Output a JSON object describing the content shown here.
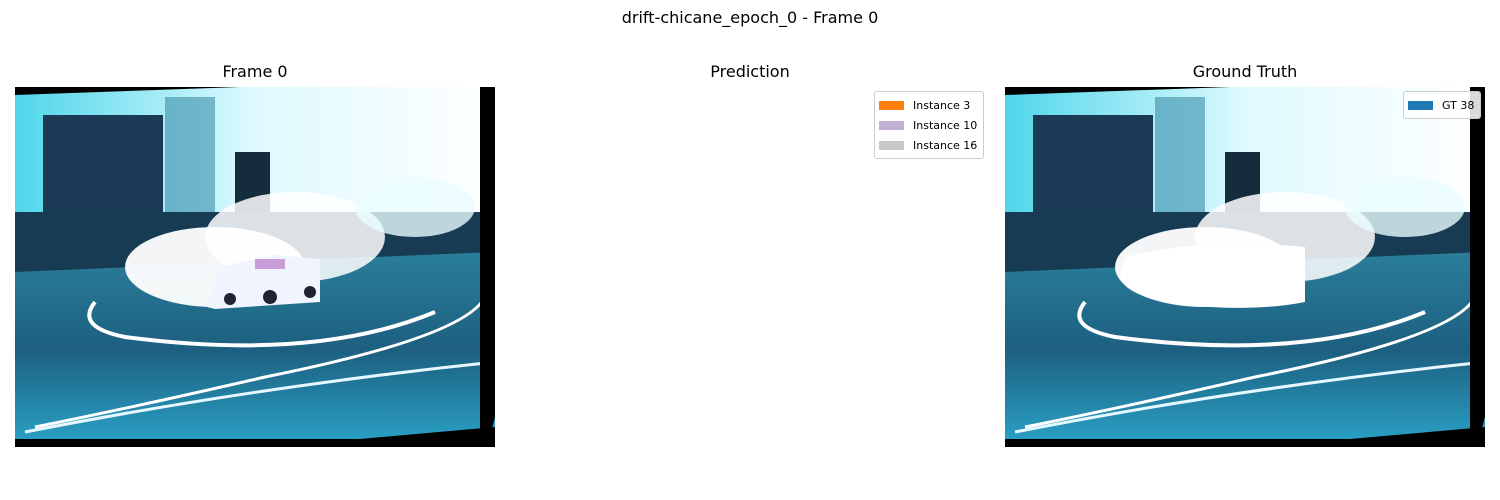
{
  "figure": {
    "suptitle": "drift-chicane_epoch_0 - Frame 0"
  },
  "axes": [
    {
      "title": "Frame 0"
    },
    {
      "title": "Prediction",
      "legend": [
        {
          "label": "Instance 3",
          "color": "#ff7f0e"
        },
        {
          "label": "Instance 10",
          "color": "#c5b0d5"
        },
        {
          "label": "Instance 16",
          "color": "#c7c7c7"
        }
      ]
    },
    {
      "title": "Ground Truth",
      "legend": [
        {
          "label": "GT 38",
          "color": "#1f77b4"
        }
      ]
    }
  ]
}
